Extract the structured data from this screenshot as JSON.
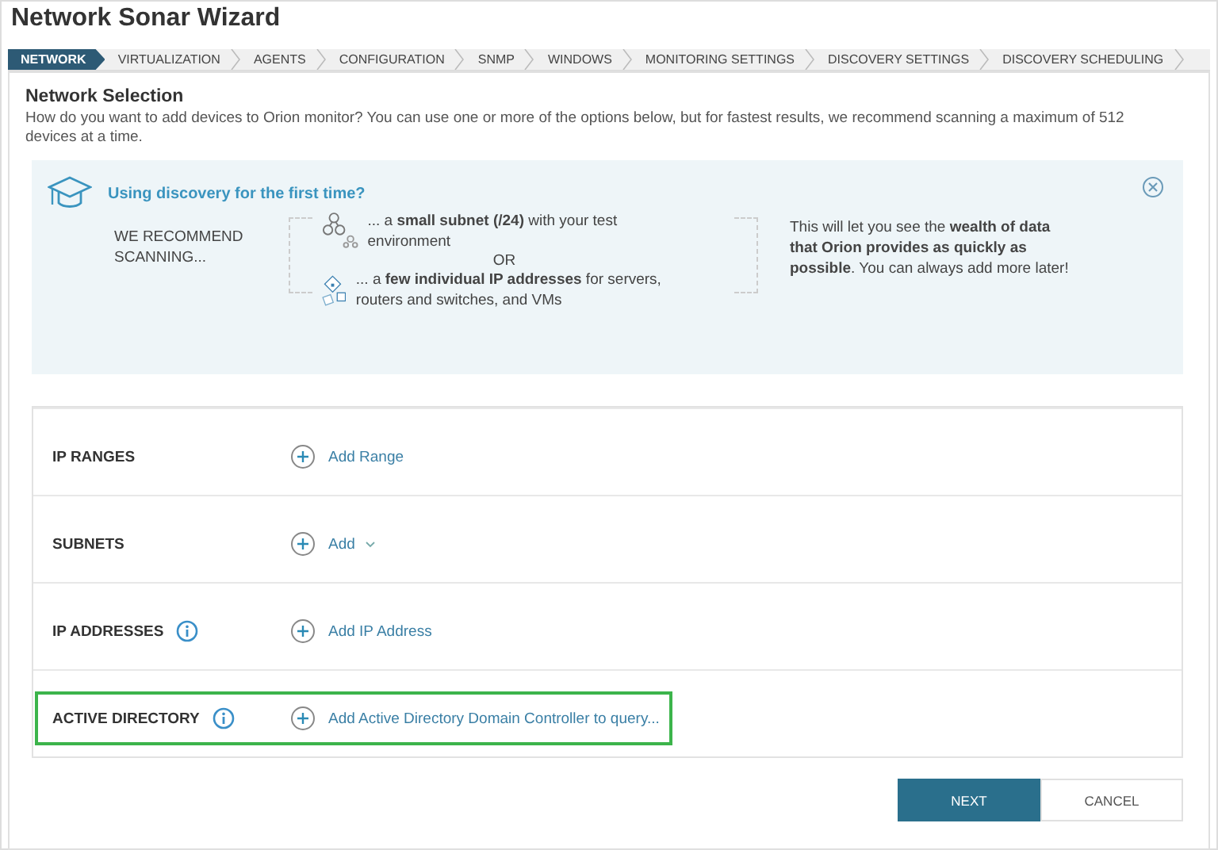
{
  "window": {
    "title": "Network Sonar Wizard"
  },
  "tabs": [
    {
      "label": "NETWORK",
      "selected": true
    },
    {
      "label": "VIRTUALIZATION",
      "selected": false
    },
    {
      "label": "AGENTS",
      "selected": false
    },
    {
      "label": "CONFIGURATION",
      "selected": false
    },
    {
      "label": "SNMP",
      "selected": false
    },
    {
      "label": "WINDOWS",
      "selected": false
    },
    {
      "label": "MONITORING SETTINGS",
      "selected": false
    },
    {
      "label": "DISCOVERY SETTINGS",
      "selected": false
    },
    {
      "label": "DISCOVERY SCHEDULING",
      "selected": false
    }
  ],
  "heading": "Network Selection",
  "description": "How do you want to add devices to Orion monitor? You can use one or more of the options below, but for fastest results, we recommend scanning a maximum of 512 devices at a time.",
  "banner": {
    "title": "Using discovery for the first time?",
    "lead": "WE RECOMMEND SCANNING...",
    "options": [
      {
        "kind": "subnet",
        "text": "... a **small subnet (/24)** with your test environment"
      },
      {
        "kind": "ip",
        "text": "... a **few individual IP addresses** for servers, routers and switches, and VMs"
      }
    ],
    "separator": "OR",
    "note": "This will let you see the **wealth of data that Orion provides as quickly as possible**. You can always add more later!"
  },
  "sections": [
    {
      "label": "IP RANGES",
      "info": false,
      "action": "Add Range",
      "dropdown": false,
      "highlighted": false
    },
    {
      "label": "SUBNETS",
      "info": false,
      "action": "Add",
      "dropdown": true,
      "highlighted": false
    },
    {
      "label": "IP ADDRESSES",
      "info": true,
      "action": "Add IP Address",
      "dropdown": false,
      "highlighted": false
    },
    {
      "label": "ACTIVE DIRECTORY",
      "info": true,
      "action": "Add Active Directory Domain Controller to query...",
      "dropdown": false,
      "highlighted": true
    }
  ],
  "buttons": [
    {
      "label": "NEXT",
      "kind": "primary"
    },
    {
      "label": "CANCEL",
      "kind": "secondary"
    }
  ]
}
